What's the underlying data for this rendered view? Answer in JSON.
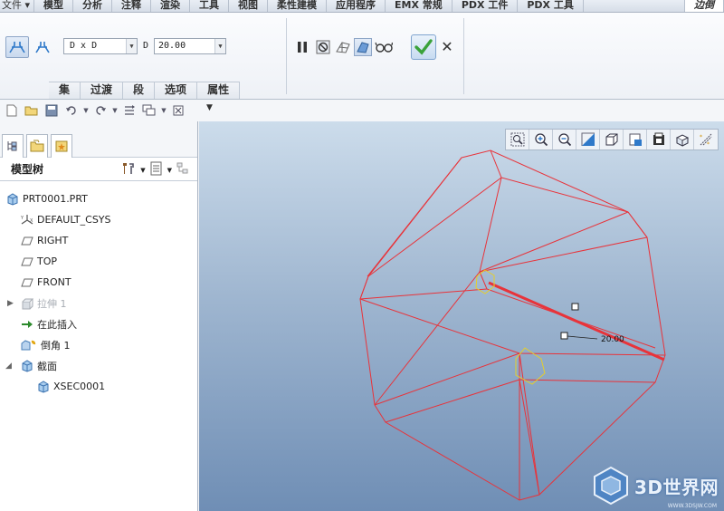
{
  "menubar": {
    "file": "文件",
    "tabs": [
      "模型",
      "分析",
      "注释",
      "渲染",
      "工具",
      "视图",
      "柔性建模",
      "应用程序",
      "EMX 常规",
      "PDX 工件",
      "PDX 工具"
    ],
    "active_tab": "边倒"
  },
  "dashboard": {
    "chamfer_type_value": "D x D",
    "d_label": "D",
    "d_value": "20.00",
    "panes": [
      "集",
      "过渡",
      "段",
      "选项",
      "属性"
    ]
  },
  "model_tree": {
    "title": "模型树",
    "items": [
      {
        "label": "PRT0001.PRT",
        "icon": "part-icon"
      },
      {
        "label": "DEFAULT_CSYS",
        "icon": "csys-icon"
      },
      {
        "label": "RIGHT",
        "icon": "datum-plane-icon"
      },
      {
        "label": "TOP",
        "icon": "datum-plane-icon"
      },
      {
        "label": "FRONT",
        "icon": "datum-plane-icon"
      },
      {
        "label": "拉伸 1",
        "icon": "extrude-icon"
      },
      {
        "label": "在此插入",
        "icon": "insert-here-arrow-icon"
      },
      {
        "label": "倒角 1",
        "icon": "chamfer-icon"
      },
      {
        "label": "截面",
        "icon": "section-icon"
      },
      {
        "label": "XSEC0001",
        "icon": "xsection-icon"
      }
    ]
  },
  "viewport": {
    "dimension_text": "20.00"
  },
  "watermark": {
    "text": "3D世界网",
    "sub": "WWW.3DSJW.COM"
  },
  "colors": {
    "edge_red": "#e8333a",
    "selection_yellow": "#e6cf2a",
    "accent_blue": "#2f79c9",
    "ok_green": "#3aa23a"
  }
}
